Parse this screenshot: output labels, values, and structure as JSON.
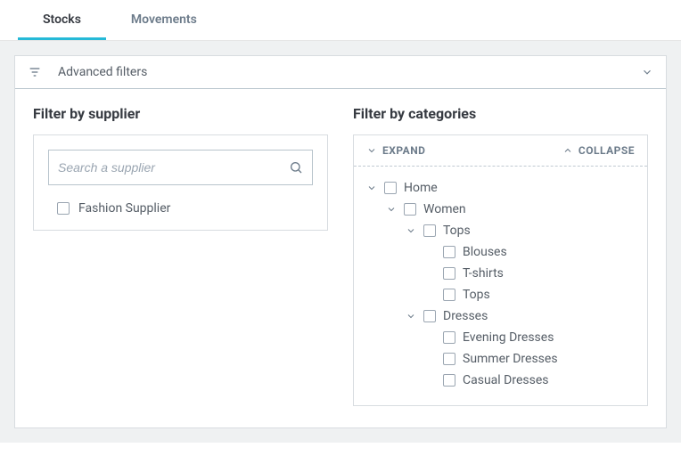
{
  "tabs": {
    "stocks": "Stocks",
    "movements": "Movements"
  },
  "advanced_filters": {
    "title": "Advanced filters"
  },
  "supplier": {
    "title": "Filter by supplier",
    "search_placeholder": "Search a supplier",
    "items": [
      "Fashion Supplier"
    ]
  },
  "categories": {
    "title": "Filter by categories",
    "expand_label": "EXPAND",
    "collapse_label": "COLLAPSE",
    "tree": [
      {
        "label": "Home",
        "depth": 0,
        "expandable": true
      },
      {
        "label": "Women",
        "depth": 1,
        "expandable": true
      },
      {
        "label": "Tops",
        "depth": 2,
        "expandable": true
      },
      {
        "label": "Blouses",
        "depth": 3,
        "expandable": false
      },
      {
        "label": "T-shirts",
        "depth": 3,
        "expandable": false
      },
      {
        "label": "Tops",
        "depth": 3,
        "expandable": false
      },
      {
        "label": "Dresses",
        "depth": 2,
        "expandable": true
      },
      {
        "label": "Evening Dresses",
        "depth": 3,
        "expandable": false
      },
      {
        "label": "Summer Dresses",
        "depth": 3,
        "expandable": false
      },
      {
        "label": "Casual Dresses",
        "depth": 3,
        "expandable": false
      }
    ]
  }
}
